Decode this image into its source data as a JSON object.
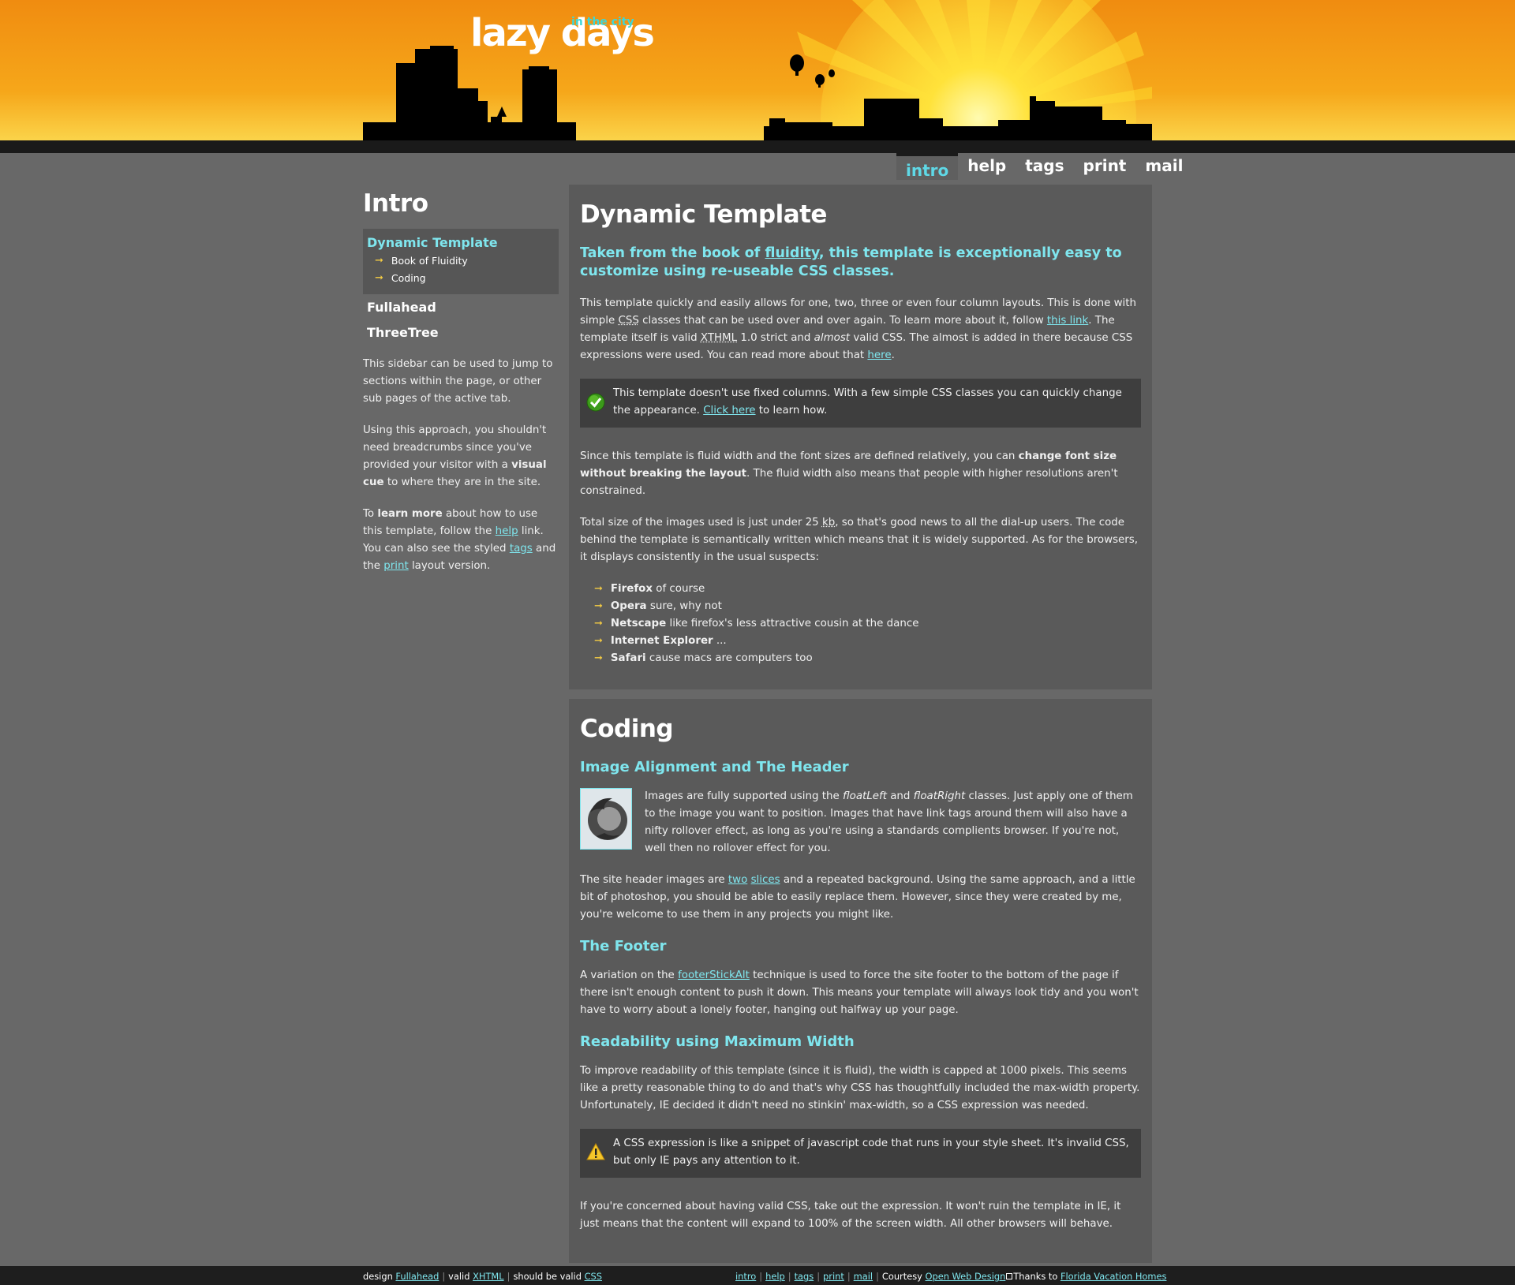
{
  "header": {
    "logo": "lazy days",
    "logo_sub": "in the city"
  },
  "nav": {
    "tabs": [
      {
        "label": "intro",
        "active": true
      },
      {
        "label": "help"
      },
      {
        "label": "tags"
      },
      {
        "label": "print"
      },
      {
        "label": "mail"
      }
    ]
  },
  "sidebar": {
    "title": "Intro",
    "active_item": "Dynamic Template",
    "sub_items": [
      "Book of Fluidity",
      "Coding"
    ],
    "items": [
      "Fullahead",
      "ThreeTree"
    ],
    "p1": "This sidebar can be used to jump to sections within the page, or other sub pages of the active tab.",
    "p2_a": "Using this approach, you shouldn't need breadcrumbs since you've provided your visitor with a ",
    "p2_b": "visual cue",
    "p2_c": " to where they are in the site.",
    "p3_a": "To ",
    "p3_b": "learn more",
    "p3_c": " about how to use this template, follow the ",
    "p3_link1": "help",
    "p3_d": " link. You can also see the styled ",
    "p3_link2": "tags",
    "p3_e": " and the ",
    "p3_link3": "print",
    "p3_f": " layout version."
  },
  "section1": {
    "title": "Dynamic Template",
    "lead_a": "Taken from the book of ",
    "lead_link": "fluidity",
    "lead_b": ", this template is exceptionally easy to customize using re-useable CSS classes.",
    "p1_a": "This template quickly and easily allows for one, two, three or even four column layouts. This is done with simple ",
    "p1_css": "CSS",
    "p1_b": " classes that can be used over and over again. To learn more about it, follow ",
    "p1_link": "this link",
    "p1_c": ". The template itself is valid ",
    "p1_xthml": "XTHML",
    "p1_d": " 1.0 strict and ",
    "p1_almost": "almost",
    "p1_e": " valid CSS. The almost is added in there because CSS expressions were used. You can read more about that ",
    "p1_link2": "here",
    "p1_f": ".",
    "box_a": "This template doesn't use fixed columns. With a few simple CSS classes you can quickly change the appearance. ",
    "box_link": "Click here",
    "box_b": " to learn how.",
    "p2_a": "Since this template is fluid width and the font sizes are defined relatively, you can ",
    "p2_bold": "change font size without breaking the layout",
    "p2_b": ". The fluid width also means that people with higher resolutions aren't constrained.",
    "p3_a": "Total size of the images used is just under 25 ",
    "p3_kb": "kb",
    "p3_b": ", so that's good news to all the dial-up users. The code behind the template is semantically written which means that it is widely supported. As for the browsers, it displays consistently in the usual suspects:",
    "browsers": [
      {
        "name": "Firefox",
        "note": " of course"
      },
      {
        "name": "Opera",
        "note": " sure, why not"
      },
      {
        "name": "Netscape",
        "note": " like firefox's less attractive cousin at the dance"
      },
      {
        "name": "Internet Explorer",
        "note": " ..."
      },
      {
        "name": "Safari",
        "note": " cause macs are computers too"
      }
    ]
  },
  "section2": {
    "title": "Coding",
    "h_img": "Image Alignment and The Header",
    "img_p_a": "Images are fully supported using the ",
    "img_p_fl": "floatLeft",
    "img_p_b": " and ",
    "img_p_fr": "floatRight",
    "img_p_c": " classes. Just apply one of them to the image you want to position. Images that have link tags around them will also have a nifty rollover effect, as long as you're using a standards complients browser. If you're not, well then no rollover effect for you.",
    "hdr_p_a": "The site header images are ",
    "hdr_link1": "two",
    "hdr_link2": "slices",
    "hdr_p_b": " and a repeated background. Using the same approach, and a little bit of photoshop, you should be able to easily replace them. However, since they were created by me, you're welcome to use them in any projects you might like.",
    "h_footer": "The Footer",
    "foot_p_a": "A variation on the ",
    "foot_link": "footerStickAlt",
    "foot_p_b": " technique is used to force the site footer to the bottom of the page if there isn't enough content to push it down. This means your template will always look tidy and you won't have to worry about a lonely footer, hanging out halfway up your page.",
    "h_read": "Readability using Maximum Width",
    "read_p": "To improve readability of this template (since it is fluid), the width is capped at 1000 pixels. This seems like a pretty reasonable thing to do and that's why CSS has thoughtfully included the max-width property. Unfortunately, IE decided it didn't need no stinkin' max-width, so a CSS expression was needed.",
    "warn": "A CSS expression is like a snippet of javascript code that runs in your style sheet. It's invalid CSS, but only IE pays any attention to it.",
    "last_p": "If you're concerned about having valid CSS, take out the expression. It won't ruin the template in IE, it just means that the content will expand to 100% of the screen width. All other browsers will behave."
  },
  "footer": {
    "design_label": "design ",
    "design_link": "Fullahead",
    "valid_label": "valid ",
    "valid_link": "XHTML",
    "should_label": "should be valid ",
    "should_link": "CSS",
    "links": [
      "intro",
      "help",
      "tags",
      "print",
      "mail"
    ],
    "courtesy_label": "Courtesy ",
    "courtesy_link": "Open Web Design",
    "thanks_label": "Thanks to ",
    "thanks_link": "Florida Vacation Homes"
  },
  "colors": {
    "accent": "#7fe6ee",
    "arrow": "#f3cb44",
    "background": "#686868",
    "panel": "#5a5a5a"
  }
}
